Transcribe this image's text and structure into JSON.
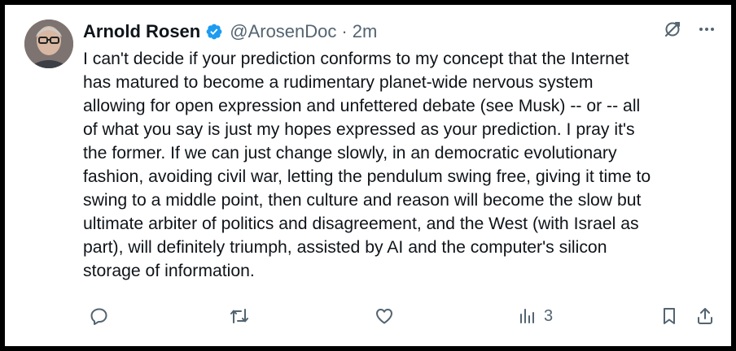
{
  "tweet": {
    "author_name": "Arnold Rosen",
    "handle": "@ArosenDoc",
    "separator": "·",
    "time": "2m",
    "text": "I can't decide if your prediction conforms to my concept that the Internet\nhas matured to become a rudimentary planet-wide nervous system\nallowing for open expression and unfettered debate (see Musk) -- or -- all\nof what you say is just my hopes expressed as your prediction. I pray it's\nthe former. If we can just change slowly, in an democratic evolutionary\nfashion, avoiding civil war, letting the pendulum swing free, giving it time to\nswing to a middle point, then culture and reason will become the slow but\nultimate arbiter of politics and disagreement, and the West (with Israel as\npart), will definitely triumph, assisted by AI and the computer's silicon\nstorage of information.",
    "views_count": "3"
  },
  "icons": {
    "verified": "verified-badge-icon",
    "grok": "grok-icon",
    "more": "more-icon",
    "reply": "reply-icon",
    "retweet": "retweet-icon",
    "like": "like-icon",
    "views": "views-icon",
    "bookmark": "bookmark-icon",
    "share": "share-icon"
  },
  "colors": {
    "verified_blue": "#1d9bf0",
    "text": "#0f1419",
    "secondary": "#536471"
  }
}
